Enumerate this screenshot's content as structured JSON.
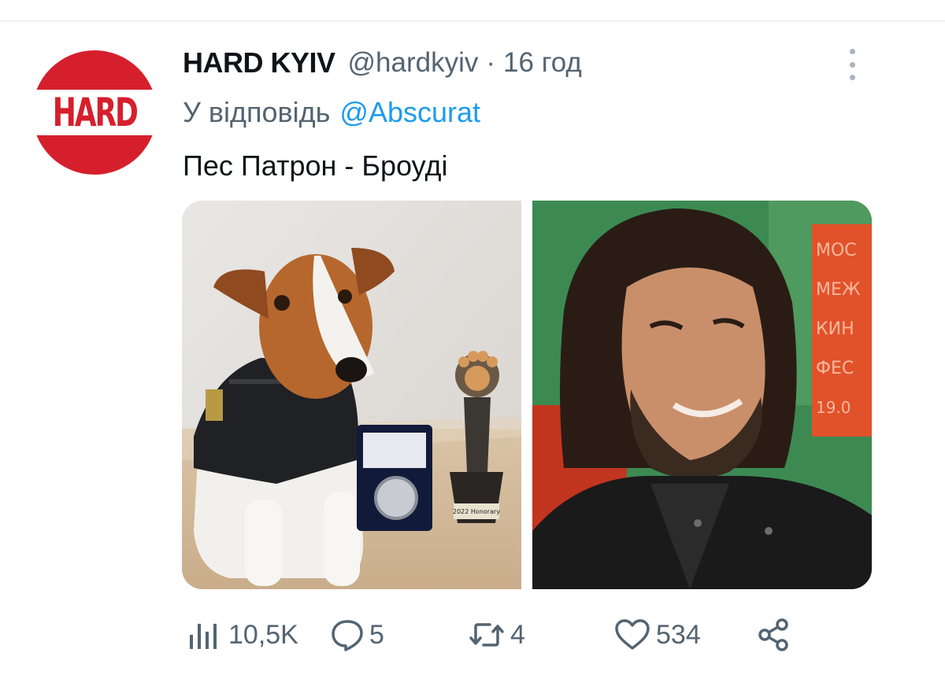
{
  "tweet": {
    "author": {
      "name": "HARD KYIV",
      "handle": "@hardkyiv",
      "avatar_text": "HARD"
    },
    "separator": "·",
    "time": "16 год",
    "reply": {
      "prefix": "У відповідь",
      "mention": "@Abscurat"
    },
    "text": "Пес Патрон - Броуді",
    "media": [
      {
        "name": "photo-dog-patron",
        "trophy_text": "2022 Honorary"
      },
      {
        "name": "photo-man",
        "sign_lines": [
          "МОС",
          "МЕЖ",
          "КИН",
          "ФЕС",
          "19.0"
        ]
      }
    ],
    "stats": {
      "views": "10,5K",
      "replies": "5",
      "retweets": "4",
      "likes": "534"
    }
  },
  "colors": {
    "brand_red": "#d61f2c",
    "mention_blue": "#1d9bf0",
    "secondary_text": "#536471",
    "primary_text": "#0f1419"
  }
}
